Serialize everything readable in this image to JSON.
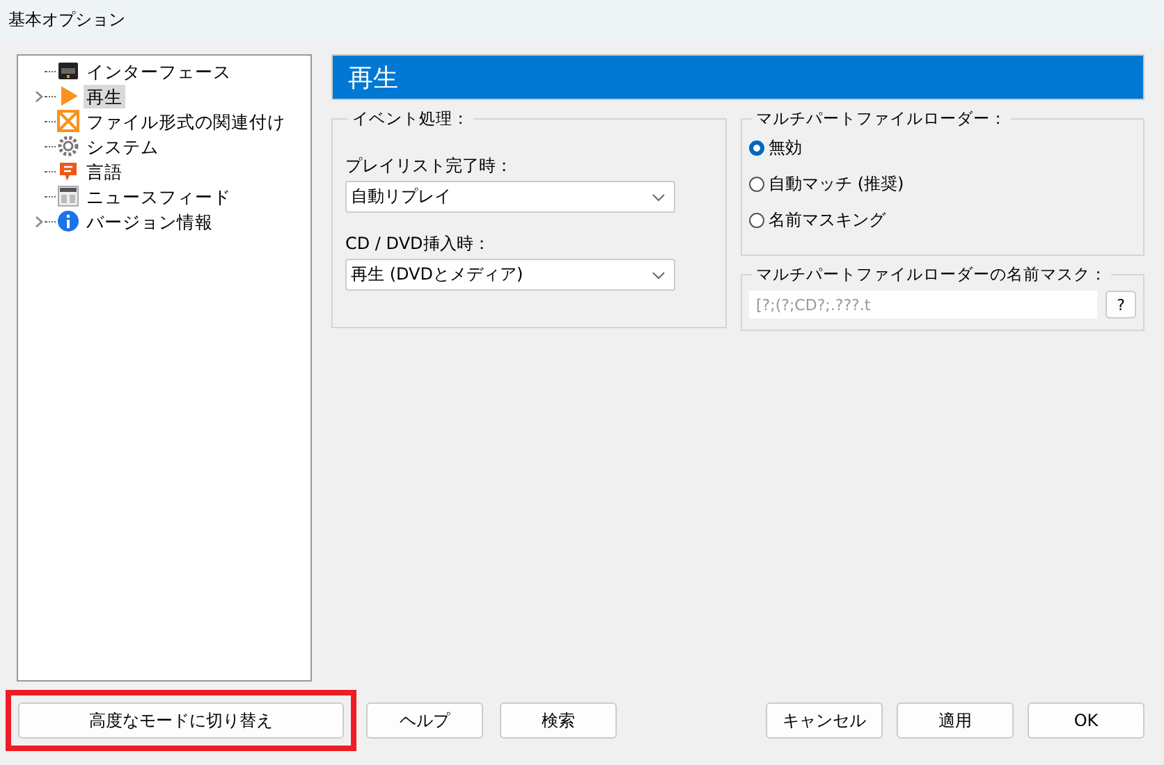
{
  "window": {
    "title": "基本オプション"
  },
  "tree": {
    "items": [
      {
        "label": "インターフェース",
        "selected": false,
        "collapsed": false
      },
      {
        "label": "再生",
        "selected": true,
        "collapsed": true
      },
      {
        "label": "ファイル形式の関連付け",
        "selected": false,
        "collapsed": false
      },
      {
        "label": "システム",
        "selected": false,
        "collapsed": false
      },
      {
        "label": "言語",
        "selected": false,
        "collapsed": false
      },
      {
        "label": "ニュースフィード",
        "selected": false,
        "collapsed": false
      },
      {
        "label": "バージョン情報",
        "selected": false,
        "collapsed": true
      }
    ]
  },
  "page_title": "再生",
  "event_group": {
    "title": "イベント処理：",
    "fields": [
      {
        "label": "プレイリスト完了時：",
        "value": "自動リプレイ"
      },
      {
        "label": "CD / DVD挿入時：",
        "value": "再生 (DVDとメディア)"
      }
    ]
  },
  "loader_group": {
    "title": "マルチパートファイルローダー：",
    "options": [
      {
        "label": "無効",
        "selected": true
      },
      {
        "label": "自動マッチ (推奨)",
        "selected": false
      },
      {
        "label": "名前マスキング",
        "selected": false
      }
    ]
  },
  "mask_group": {
    "title": "マルチパートファイルローダーの名前マスク：",
    "placeholder": "[?;(?;CD?;.???.t",
    "help": "?"
  },
  "buttons_left": [
    {
      "label": "高度なモードに切り替え",
      "highlighted": true
    },
    {
      "label": "ヘルプ"
    },
    {
      "label": "検索"
    }
  ],
  "buttons_right": [
    {
      "label": "キャンセル"
    },
    {
      "label": "適用"
    },
    {
      "label": "OK"
    }
  ]
}
